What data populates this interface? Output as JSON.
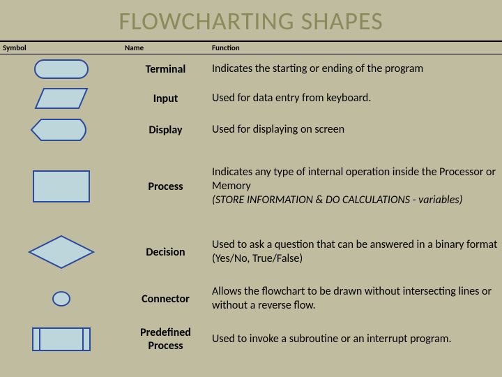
{
  "title": "FLOWCHARTING SHAPES",
  "headers": {
    "symbol": "Symbol",
    "name": "Name",
    "function": "Function"
  },
  "rows": [
    {
      "shape": "terminal",
      "name": "Terminal",
      "function": "Indicates the starting or ending of the program"
    },
    {
      "shape": "input",
      "name": "Input",
      "function": "Used for data entry from keyboard."
    },
    {
      "shape": "display",
      "name": "Display",
      "function": "Used for displaying on screen"
    },
    {
      "shape": "process",
      "name": "Process",
      "function": "Indicates any type of internal operation inside the Processor or Memory\n(STORE INFORMATION & DO CALCULATIONS - variables)",
      "italics": "(STORE INFORMATION & DO CALCULATIONS - variables)"
    },
    {
      "shape": "decision",
      "name": "Decision",
      "function": "Used to ask a question that can be answered in a binary format (Yes/No, True/False)"
    },
    {
      "shape": "connector",
      "name": "Connector",
      "function": "Allows the flowchart to be drawn without intersecting lines or without a reverse flow."
    },
    {
      "shape": "predef",
      "name": "Predefined Process",
      "function": "Used to invoke a subroutine or an interrupt program."
    }
  ],
  "colors": {
    "shapeFill": "#bcd6dc",
    "shapeStroke": "#2a4aa0"
  }
}
